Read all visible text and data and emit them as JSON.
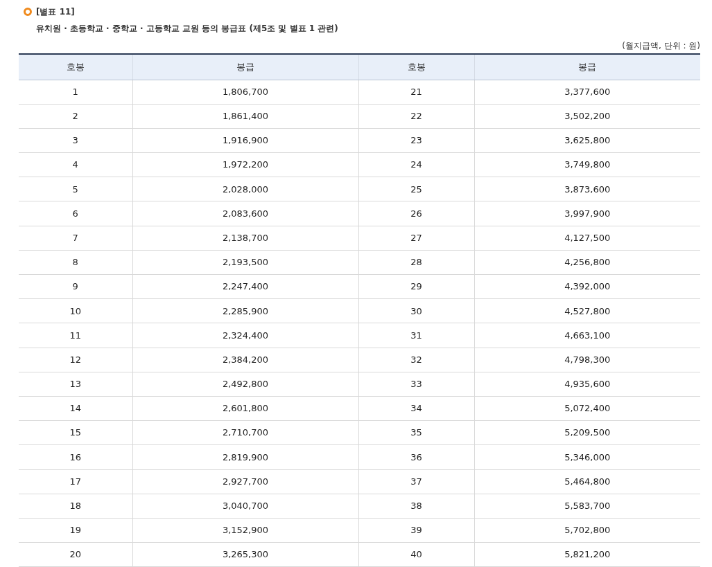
{
  "table_label": "[별표 11]",
  "title": "유치원 · 초등학교 · 중학교 · 고등학교 교원 등의 봉급표 (제5조 및 별표 1 관련)",
  "unit_note": "(월지급액, 단위 : 원)",
  "table": {
    "columns": [
      "호봉",
      "봉급",
      "호봉",
      "봉급"
    ],
    "rows": [
      [
        "1",
        "1,806,700",
        "21",
        "3,377,600"
      ],
      [
        "2",
        "1,861,400",
        "22",
        "3,502,200"
      ],
      [
        "3",
        "1,916,900",
        "23",
        "3,625,800"
      ],
      [
        "4",
        "1,972,200",
        "24",
        "3,749,800"
      ],
      [
        "5",
        "2,028,000",
        "25",
        "3,873,600"
      ],
      [
        "6",
        "2,083,600",
        "26",
        "3,997,900"
      ],
      [
        "7",
        "2,138,700",
        "27",
        "4,127,500"
      ],
      [
        "8",
        "2,193,500",
        "28",
        "4,256,800"
      ],
      [
        "9",
        "2,247,400",
        "29",
        "4,392,000"
      ],
      [
        "10",
        "2,285,900",
        "30",
        "4,527,800"
      ],
      [
        "11",
        "2,324,400",
        "31",
        "4,663,100"
      ],
      [
        "12",
        "2,384,200",
        "32",
        "4,798,300"
      ],
      [
        "13",
        "2,492,800",
        "33",
        "4,935,600"
      ],
      [
        "14",
        "2,601,800",
        "34",
        "5,072,400"
      ],
      [
        "15",
        "2,710,700",
        "35",
        "5,209,500"
      ],
      [
        "16",
        "2,819,900",
        "36",
        "5,346,000"
      ],
      [
        "17",
        "2,927,700",
        "37",
        "5,464,800"
      ],
      [
        "18",
        "3,040,700",
        "38",
        "5,583,700"
      ],
      [
        "19",
        "3,152,900",
        "39",
        "5,702,800"
      ],
      [
        "20",
        "3,265,300",
        "40",
        "5,821,200"
      ]
    ]
  }
}
